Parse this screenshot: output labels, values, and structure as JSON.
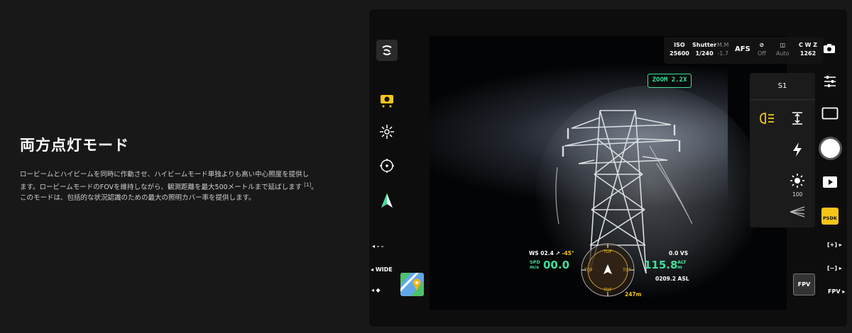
{
  "page": {
    "heading": "両方点灯モード",
    "description": {
      "line1": "ロービームとハイビームを同時に作動させ、ハイビームモード単独よりも高い中心照度を提供し",
      "line2": "ます。ロービームモードのFOVを維持しながら、観測距離を最大500メートルまで延ばします",
      "line2_ref": "[1]",
      "line2_tail": "。",
      "line3": "このモードは、包括的な状況認識のための最大の照明カバー率を提供します。"
    }
  },
  "camera": {
    "zoom_label": "ZOOM 2.2X",
    "top_bar": {
      "iso_label": "ISO",
      "iso_value": "25600",
      "shutter_label": "Shutter",
      "shutter_value": "1/240",
      "mm_label": "M.M",
      "mm_value": "-1.7",
      "focus_mode": "AFS",
      "mute_value": "Off",
      "wb_value": "Auto",
      "storage_label": "C W Z",
      "storage_value": "1262"
    },
    "left_bar": {
      "wide_label": "WIDE",
      "dash_label": "- -"
    },
    "right_panel": {
      "mode_title": "S1",
      "brightness_value": "100"
    },
    "right_bar": {
      "psdk_label": "PSDK",
      "zoom_in_label": "[+]",
      "zoom_out_label": "[−]",
      "fpv_label": "FPV",
      "fpv_box_label": "FPV"
    },
    "hud": {
      "ws_label": "WS 02.4",
      "ws_angle": "-45°",
      "spd_label": "SPD",
      "spd_unit": "m/s",
      "spd_value": "00.0",
      "alt_value": "115.8",
      "alt_label": "ALT",
      "alt_unit": "m",
      "vs_label": "0.0 VS",
      "asl_label": "0209.2 ASL",
      "distance_value": "247m",
      "tof_label": "TOF"
    }
  },
  "colors": {
    "accent_green": "#3fe09a",
    "accent_yellow": "#f5c518"
  }
}
